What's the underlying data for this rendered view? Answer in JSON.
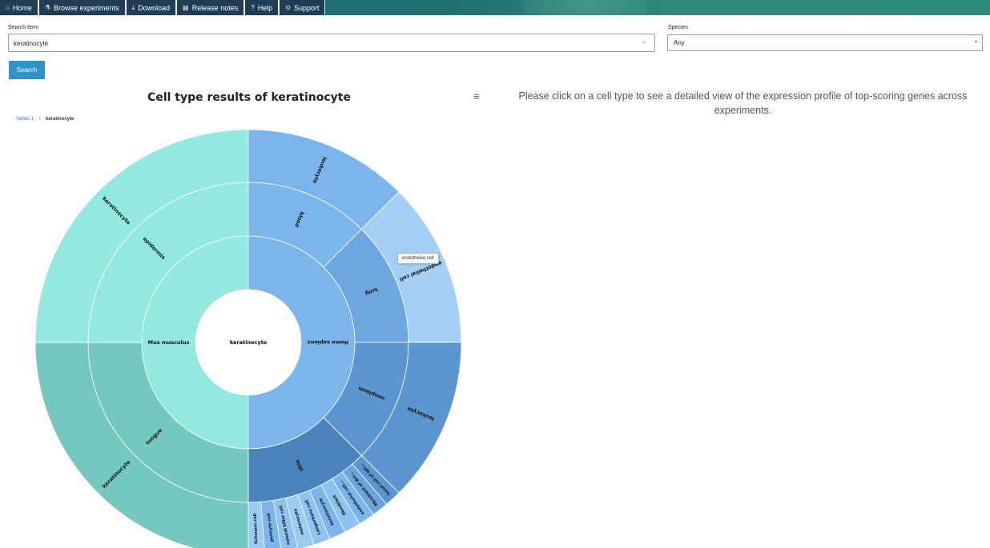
{
  "nav": [
    {
      "icon": "home-icon",
      "glyph": "⌂",
      "label": "Home"
    },
    {
      "icon": "flask-icon",
      "glyph": "⚗",
      "label": "Browse experiments"
    },
    {
      "icon": "download-icon",
      "glyph": "⤓",
      "label": "Download"
    },
    {
      "icon": "notes-icon",
      "glyph": "▤",
      "label": "Release notes"
    },
    {
      "icon": "help-icon",
      "glyph": "?",
      "label": "Help"
    },
    {
      "icon": "support-icon",
      "glyph": "⊙",
      "label": "Support"
    }
  ],
  "search": {
    "label": "Search term",
    "value": "keratinocyte",
    "clear": "×"
  },
  "species": {
    "label": "Species",
    "value": "Any",
    "caret": "▾"
  },
  "search_button": "Search",
  "chart": {
    "title": "Cell type results of keratinocyte",
    "menu_icon": "≡",
    "breadcrumb": {
      "series": "Series 1",
      "separator": "/",
      "current": "keratinocyte"
    },
    "tooltip": "endothelial cell"
  },
  "info_text": "Please click on a cell type to see a detailed view of the expression profile of top-scoring genes across experiments.",
  "chart_data": {
    "type": "sunburst",
    "center": "keratinocyte",
    "tree": [
      {
        "name": "Mus musculus",
        "value": 50,
        "color": "#93e8e0",
        "children": [
          {
            "name": "tongue",
            "value": 25,
            "color": "#74c8bf",
            "children": [
              {
                "name": "keratinocyte",
                "value": 25,
                "color": "#74c8bf"
              }
            ]
          },
          {
            "name": "epidermis",
            "value": 25,
            "color": "#93e8e0",
            "children": [
              {
                "name": "keratinocyte",
                "value": 25,
                "color": "#93e8e0"
              }
            ]
          }
        ]
      },
      {
        "name": "Homo sapiens",
        "value": 50,
        "color": "#7cb5ec",
        "children": [
          {
            "name": "blood",
            "value": 12.5,
            "color": "#7cb5ec",
            "children": [
              {
                "name": "leukocyte",
                "value": 12.5,
                "color": "#7cb5ec"
              }
            ]
          },
          {
            "name": "lung",
            "value": 12.5,
            "color": "#6ea6df",
            "children": [
              {
                "name": "endothelial cell",
                "value": 12.5,
                "color": "#a6cff5"
              }
            ]
          },
          {
            "name": "neoplasm",
            "value": 12.5,
            "color": "#5b96d0",
            "children": [
              {
                "name": "leukocyte",
                "value": 12.5,
                "color": "#5b96d0"
              }
            ]
          },
          {
            "name": "skin",
            "value": 12.5,
            "color": "#4a83bd",
            "children": [
              {
                "name": "basal cell of epi...",
                "value": 1.25,
                "color": "#5b96d0"
              },
              {
                "name": "fibroblast of der...",
                "value": 1.25,
                "color": "#6ba5dd"
              },
              {
                "name": "endothelial cell...",
                "value": 1.25,
                "color": "#7cb5ec"
              },
              {
                "name": "fibroblast",
                "value": 1.25,
                "color": "#8ec2f0"
              },
              {
                "name": "keratinocyte",
                "value": 1.25,
                "color": "#7cb5ec"
              },
              {
                "name": "Langerhans cell",
                "value": 1.25,
                "color": "#8ec2f0"
              },
              {
                "name": "melanocyte",
                "value": 1.25,
                "color": "#9ccbf3"
              },
              {
                "name": "natural killer cell",
                "value": 1.25,
                "color": "#8ec2f0"
              },
              {
                "name": "pericyte cell",
                "value": 1.25,
                "color": "#7cb5ec"
              },
              {
                "name": "Schwann cell",
                "value": 1.25,
                "color": "#9ccbf3"
              }
            ]
          }
        ]
      }
    ]
  }
}
